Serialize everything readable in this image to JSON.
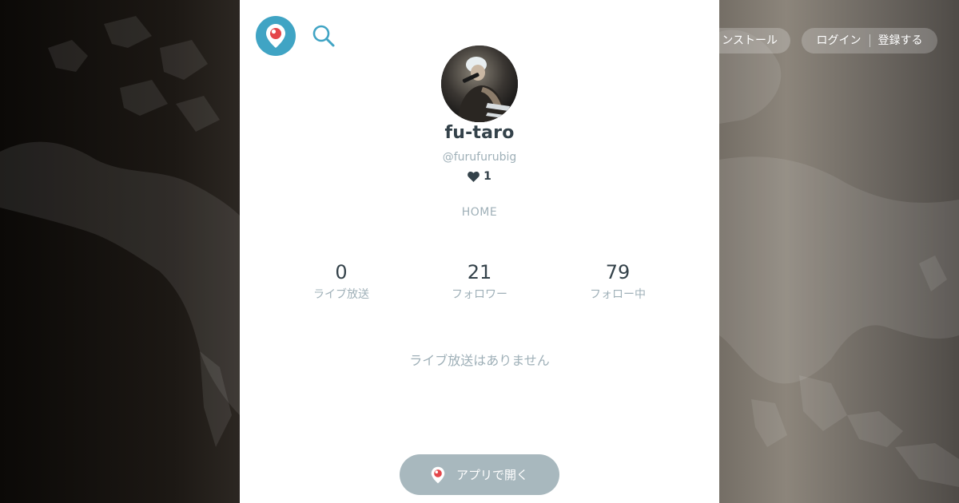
{
  "header": {
    "install_label": "ンストール",
    "login_label": "ログイン",
    "register_label": "登録する"
  },
  "profile": {
    "display_name": "fu-taro",
    "username": "@furufurubig",
    "hearts": "1",
    "home_link": "HOME"
  },
  "stats": [
    {
      "value": "0",
      "label": "ライブ放送"
    },
    {
      "value": "21",
      "label": "フォロワー"
    },
    {
      "value": "79",
      "label": "フォロー中"
    }
  ],
  "broadcasts": {
    "empty_message": "ライブ放送はありません"
  },
  "cta": {
    "open_app_label": "アプリで開く"
  },
  "icons": {
    "logo": "periscope-logo-icon",
    "search": "search-icon",
    "heart": "heart-icon",
    "pin": "periscope-pin-icon"
  },
  "colors": {
    "brand": "#40a4c4",
    "brand_red": "#e4464a",
    "text_dark": "#34424a",
    "text_muted": "#9fb0b8",
    "button_bg": "#a8b8be"
  }
}
